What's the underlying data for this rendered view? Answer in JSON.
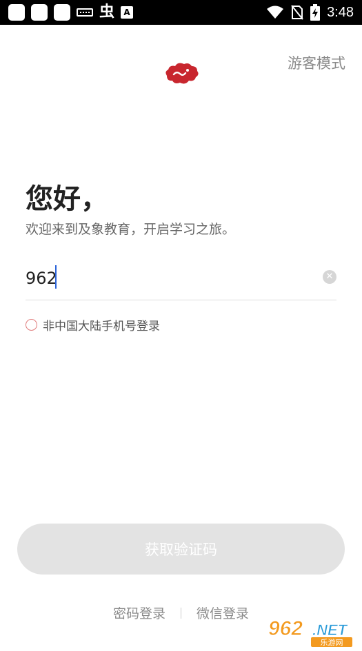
{
  "status_bar": {
    "time": "3:48",
    "glyph": "虫",
    "badge": "A",
    "icons": [
      "app-icon",
      "app-icon",
      "app-icon",
      "keyboard-icon",
      "bug-icon",
      "notification-a-icon",
      "wifi-icon",
      "no-sim-icon",
      "battery-charging-icon"
    ]
  },
  "header": {
    "guest_mode": "游客模式"
  },
  "brand": {
    "logo_icon": "cloud-logo-icon",
    "logo_color": "#c8262e"
  },
  "login": {
    "greeting": "您好，",
    "subtitle": "欢迎来到及象教育，开启学习之旅。",
    "phone_value": "962",
    "clear_icon": "clear-circle-icon",
    "non_mainland_label": "非中国大陆手机号登录",
    "get_code_button": "获取验证码"
  },
  "footer": {
    "password_login": "密码登录",
    "wechat_login": "微信登录"
  },
  "watermark": {
    "text_main": "962",
    "text_net": ".NET",
    "text_sub": "乐游网"
  },
  "colors": {
    "accent_caret": "#2b63d9",
    "radio_border": "#e07b7b",
    "button_disabled_bg": "#e3e3e3",
    "watermark_orange": "#f39a1f"
  }
}
